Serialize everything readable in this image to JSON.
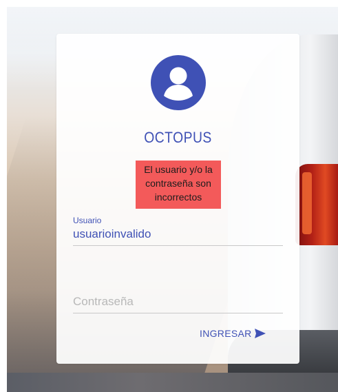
{
  "app": {
    "brand": "OCTOPUS"
  },
  "alert": {
    "message": "El usuario y/o la contraseña son incorrectos"
  },
  "form": {
    "username": {
      "label": "Usuario",
      "value": "usuarioinvalido"
    },
    "password": {
      "placeholder": "Contraseña",
      "value": ""
    },
    "submit_label": "INGRESAR"
  },
  "icons": {
    "avatar": "account-circle-icon",
    "submit": "send-icon"
  },
  "colors": {
    "accent": "#3f51b5",
    "error_bg": "#f35a5a"
  }
}
